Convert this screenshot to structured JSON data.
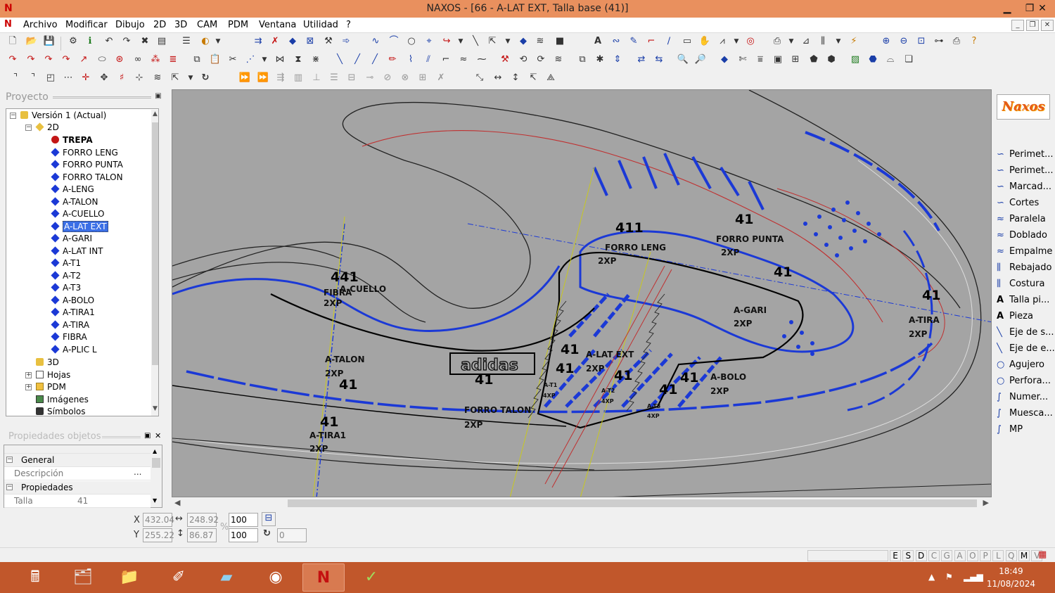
{
  "window": {
    "title": "NAXOS - [66 - A-LAT EXT, Talla base (41)]"
  },
  "menu": [
    "Archivo",
    "Modificar",
    "Dibujo",
    "2D",
    "3D",
    "CAM",
    "PDM",
    "Ventana",
    "Utilidad",
    "?"
  ],
  "project_panel": {
    "title": "Proyecto",
    "tree": {
      "version": "Versión 1 (Actual)",
      "node_2d": "2D",
      "pieces": [
        {
          "label": "TREPA",
          "bold": true
        },
        {
          "label": "FORRO LENG"
        },
        {
          "label": "FORRO PUNTA"
        },
        {
          "label": "FORRO TALON"
        },
        {
          "label": "A-LENG"
        },
        {
          "label": "A-TALON"
        },
        {
          "label": "A-CUELLO"
        },
        {
          "label": "A-LAT EXT",
          "selected": true
        },
        {
          "label": "A-GARI"
        },
        {
          "label": "A-LAT INT"
        },
        {
          "label": "A-T1"
        },
        {
          "label": "A-T2"
        },
        {
          "label": "A-T3"
        },
        {
          "label": "A-BOLO"
        },
        {
          "label": "A-TIRA1"
        },
        {
          "label": "A-TIRA"
        },
        {
          "label": "FIBRA"
        },
        {
          "label": "A-PLIC L"
        }
      ],
      "node_3d": "3D",
      "hojas": "Hojas",
      "pdm": "PDM",
      "imagenes": "Imágenes",
      "simbolos": "Símbolos"
    }
  },
  "props_panel": {
    "title": "Propiedades objetos",
    "general": "General",
    "descripcion_label": "Descripción",
    "descripcion_value": "",
    "propiedades": "Propiedades",
    "talla_label": "Talla",
    "talla_value": "41",
    "ellipsis": "..."
  },
  "right_tools": {
    "logo": "Naxos",
    "items": [
      {
        "label": "Perimet...",
        "icon": "curve-icon"
      },
      {
        "label": "Perimet...",
        "icon": "curve-icon"
      },
      {
        "label": "Marcad...",
        "icon": "curve-icon"
      },
      {
        "label": "Cortes",
        "icon": "curve-icon"
      },
      {
        "label": "Paralela",
        "icon": "double-curve-icon"
      },
      {
        "label": "Doblado",
        "icon": "double-curve-icon"
      },
      {
        "label": "Empalme",
        "icon": "double-curve-icon"
      },
      {
        "label": "Rebajado",
        "icon": "seam-icon"
      },
      {
        "label": "Costura",
        "icon": "seam-icon"
      },
      {
        "label": "Talla pi...",
        "icon": "text-icon"
      },
      {
        "label": "Pieza",
        "icon": "text-icon"
      },
      {
        "label": "Eje de s...",
        "icon": "axis-icon"
      },
      {
        "label": "Eje de e...",
        "icon": "axis-icon"
      },
      {
        "label": "Agujero",
        "icon": "circle-icon"
      },
      {
        "label": "Perfora...",
        "icon": "circle-icon"
      },
      {
        "label": "Numer...",
        "icon": "pen-icon"
      },
      {
        "label": "Muesca...",
        "icon": "pen-icon"
      },
      {
        "label": "MP",
        "icon": "pen-icon"
      }
    ]
  },
  "canvas_labels": {
    "size": "41",
    "size_4": "441",
    "size_3": "411",
    "xp2": "2XP",
    "xp4": "4XP",
    "forro_punta": "FORRO PUNTA",
    "forro_leng": "FORRO LENG",
    "forro_talon": "FORRO TALON",
    "a_cuello": "A-CUELLO",
    "fibra": "FIBRA",
    "a_talon": "A-TALON",
    "a_tira1": "A-TIRA1",
    "a_lat_ext": "A-LAT EXT",
    "a_gari": "A-GARI",
    "a_bolo": "A-BOLO",
    "a_tira": "A-TIRA",
    "a_t1": "A-T1",
    "a_t2": "A-T2",
    "a_t3": "A-T3",
    "brand": "adidas"
  },
  "coords": {
    "x_label": "X",
    "y_label": "Y",
    "x": "432.04",
    "y": "255.22",
    "w": "248.92",
    "h": "86.87",
    "sx": "100",
    "sy": "100",
    "pct": "%",
    "rot": "0"
  },
  "status_letters": [
    "E",
    "S",
    "D",
    "C",
    "G",
    "A",
    "O",
    "P",
    "L",
    "Q",
    "M",
    "V"
  ],
  "status_active": [
    "E",
    "S",
    "D",
    "M"
  ],
  "clock": {
    "time": "18:49",
    "date": "11/08/2024"
  },
  "colors": {
    "titlebar": "#e9905e",
    "taskbar": "#c1572b",
    "canvas": "#a4a4a4",
    "piece_blue": "#1b39d6"
  }
}
